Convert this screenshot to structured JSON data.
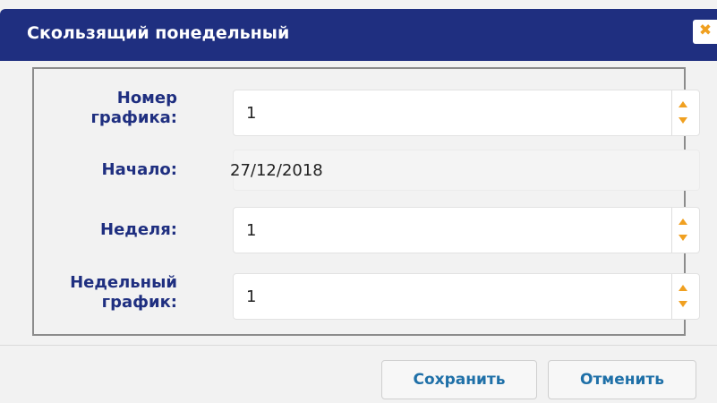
{
  "dialog": {
    "title": "Скользящий понедельный",
    "close_icon": "close-icon"
  },
  "form": {
    "schedule_number": {
      "label_line1": "Номер",
      "label_line2": "графика:",
      "value": "1"
    },
    "start": {
      "label": "Начало:",
      "value": "27/12/2018"
    },
    "week": {
      "label": "Неделя:",
      "value": "1"
    },
    "weekly_schedule": {
      "label_line1": "Недельный",
      "label_line2": "график:",
      "value": "1"
    }
  },
  "buttons": {
    "save": "Сохранить",
    "cancel": "Отменить"
  },
  "colors": {
    "titlebar": "#1f2f80",
    "label": "#1f2f80",
    "accent_orange": "#f0a020",
    "button_text": "#1f70a8"
  }
}
